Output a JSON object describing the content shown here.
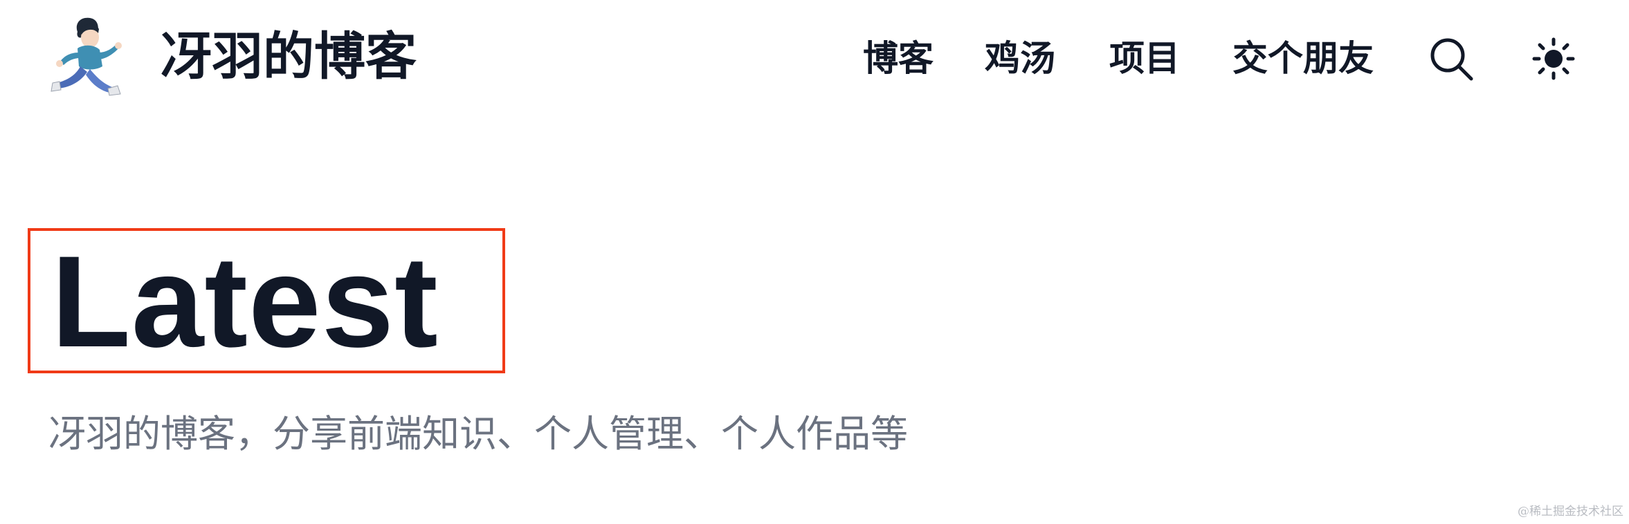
{
  "header": {
    "logo_alt": "running boy avatar",
    "site_title": "冴羽的博客",
    "nav": [
      {
        "label": "博客"
      },
      {
        "label": "鸡汤"
      },
      {
        "label": "项目"
      },
      {
        "label": "交个朋友"
      }
    ],
    "search_icon": "search-icon",
    "theme_icon": "sun-icon"
  },
  "hero": {
    "heading": "Latest",
    "subtitle": "冴羽的博客，分享前端知识、个人管理、个人作品等"
  },
  "watermark": "@稀土掘金技术社区",
  "colors": {
    "text_primary": "#111827",
    "text_muted": "#6b7280",
    "highlight_border": "#f03a17",
    "background": "#ffffff"
  }
}
